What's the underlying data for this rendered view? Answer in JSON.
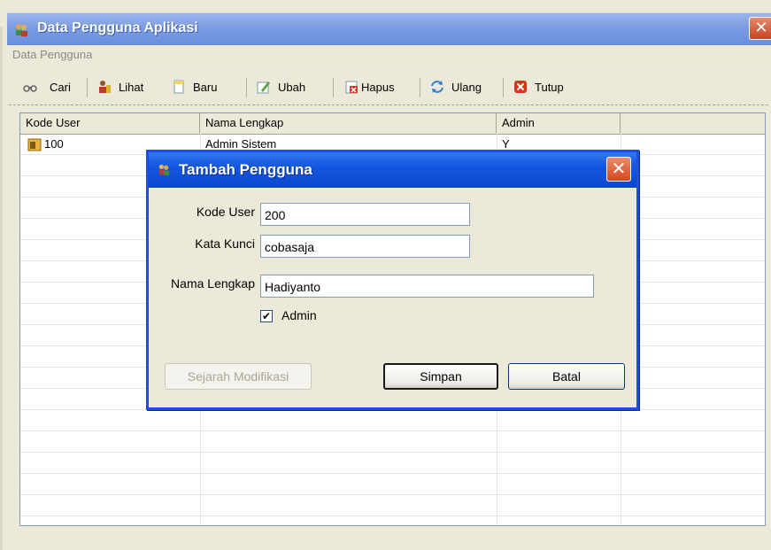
{
  "window": {
    "title": "Data Pengguna Aplikasi",
    "close_glyph": "✕"
  },
  "menu": {
    "label": "Data Pengguna"
  },
  "toolbar": {
    "items": [
      {
        "label": "Cari",
        "icon": "binoculars-icon"
      },
      {
        "label": "Lihat",
        "icon": "user-view-icon"
      },
      {
        "label": "Baru",
        "icon": "new-document-icon"
      },
      {
        "label": "Ubah",
        "icon": "edit-icon"
      },
      {
        "label": "Hapus",
        "icon": "delete-icon"
      },
      {
        "label": "Ulang",
        "icon": "refresh-icon"
      },
      {
        "label": "Tutup",
        "icon": "close-icon"
      }
    ]
  },
  "grid": {
    "headers": [
      "Kode User",
      "Nama Lengkap",
      "Admin"
    ],
    "rows": [
      {
        "kode": "100",
        "nama": "Admin Sistem",
        "admin": "Y"
      }
    ]
  },
  "dialog": {
    "title": "Tambah Pengguna",
    "close_glyph": "✕",
    "fields": {
      "kode_user": {
        "label": "Kode User",
        "value": "200"
      },
      "kata_kunci": {
        "label": "Kata Kunci",
        "value": "cobasaja"
      },
      "nama_lengkap": {
        "label": "Nama Lengkap",
        "value": "Hadiyanto"
      }
    },
    "admin_checkbox": {
      "label": "Admin",
      "checked": true,
      "mark": "✔"
    },
    "buttons": {
      "history": "Sejarah Modifikasi",
      "save": "Simpan",
      "cancel": "Batal"
    }
  },
  "colors": {
    "dialog_title": "#1457e0",
    "window_title": "#7a9ce2",
    "close_red": "#c8411d"
  }
}
